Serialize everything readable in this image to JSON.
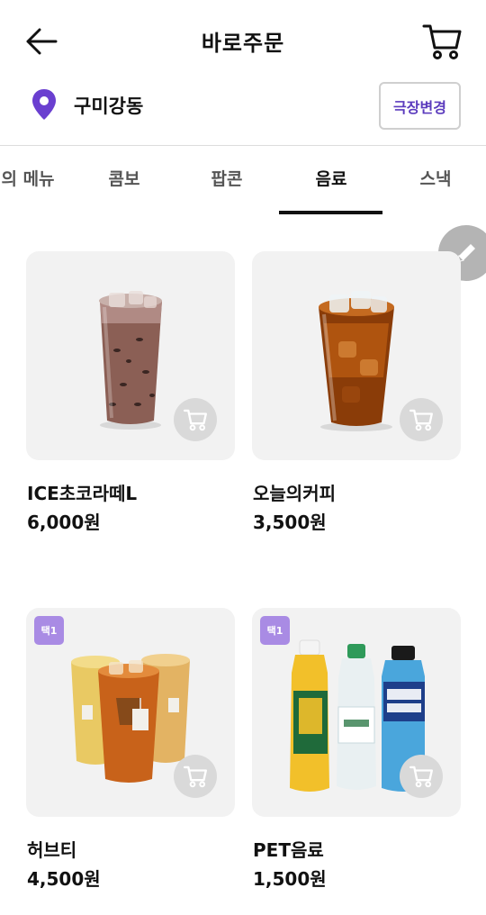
{
  "header": {
    "title": "바로주문"
  },
  "location": {
    "name": "구미강동",
    "change_label": "극장변경"
  },
  "tabs": [
    {
      "label": "의 메뉴",
      "active": false
    },
    {
      "label": "콤보",
      "active": false
    },
    {
      "label": "팝콘",
      "active": false
    },
    {
      "label": "음료",
      "active": true
    },
    {
      "label": "스낵",
      "active": false
    }
  ],
  "products": [
    {
      "name": "ICE초코라떼L",
      "price": "6,000원",
      "badge": ""
    },
    {
      "name": "오늘의커피",
      "price": "3,500원",
      "badge": ""
    },
    {
      "name": "허브티",
      "price": "4,500원",
      "badge": "택1"
    },
    {
      "name": "PET음료",
      "price": "1,500원",
      "badge": "택1"
    }
  ],
  "icons": {
    "back": "arrow-left-icon",
    "cart": "cart-icon",
    "location": "map-pin-icon",
    "edit": "pencil-icon",
    "add_to_cart": "cart-icon"
  },
  "colors": {
    "accent": "#5b3bbd",
    "pin": "#6a3fd0",
    "badge": "#a98be4",
    "card_bg": "#f2f2f2",
    "fab": "#b4b4b4"
  }
}
